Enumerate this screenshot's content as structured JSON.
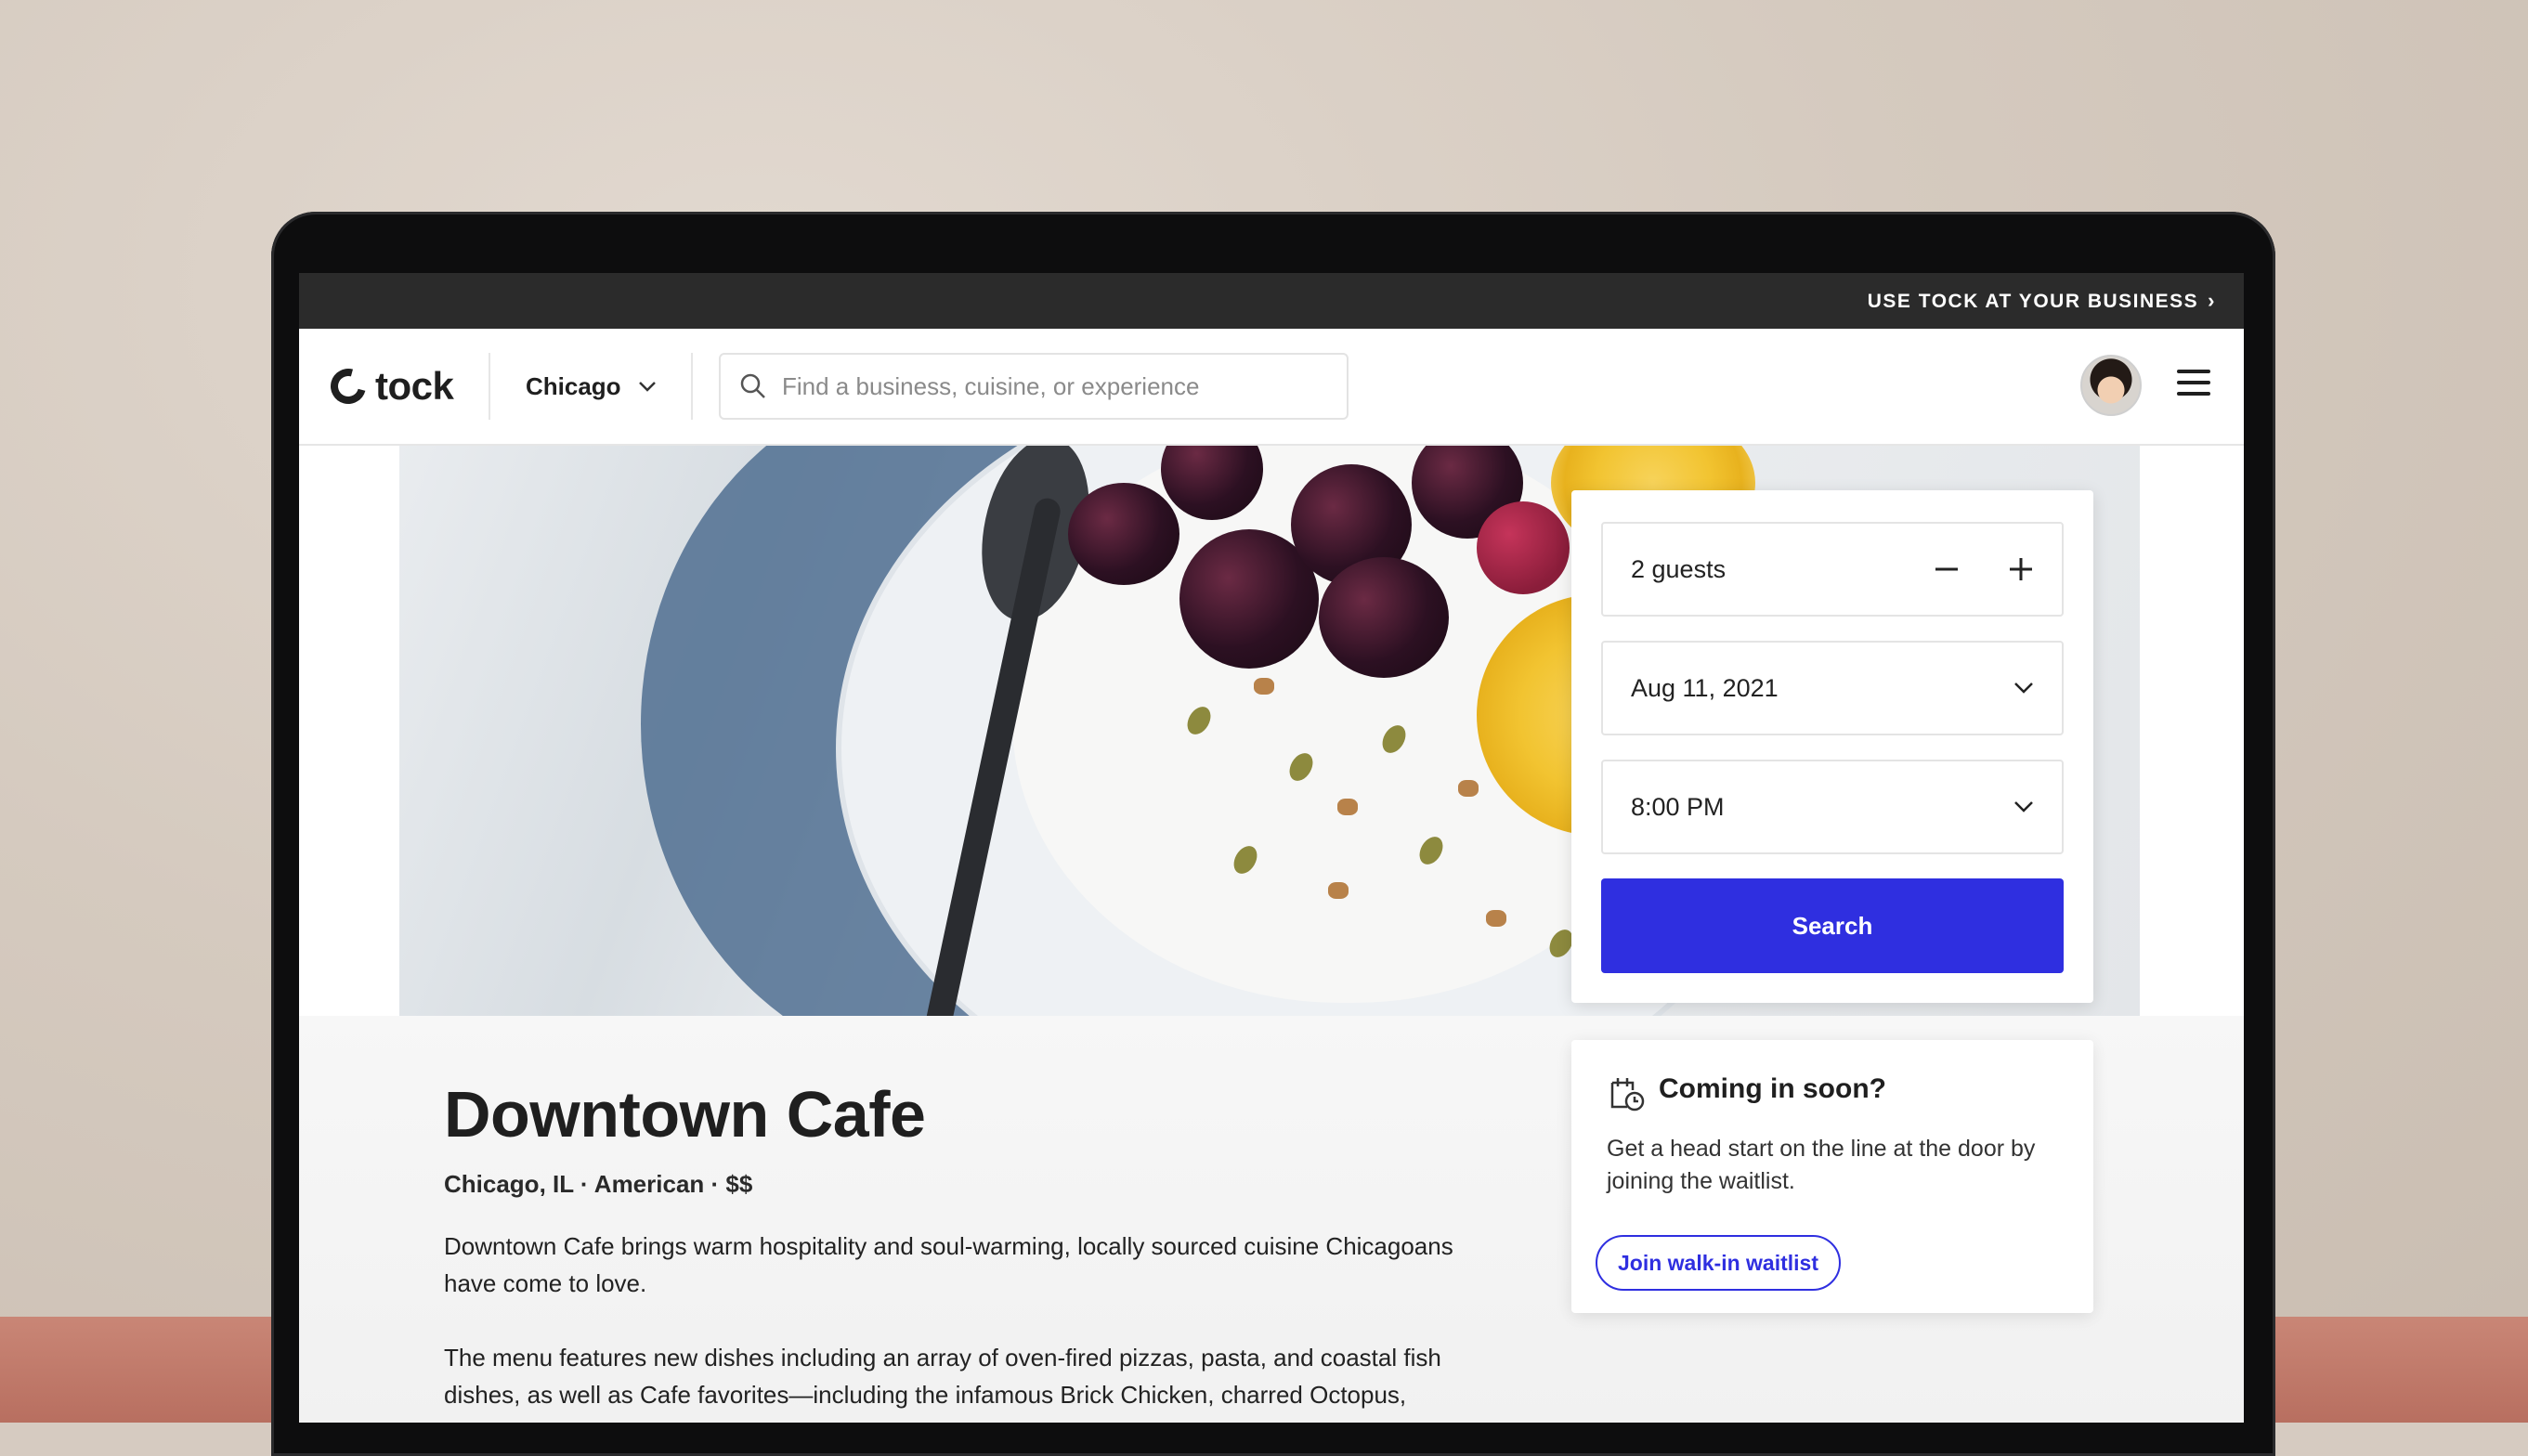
{
  "promo": {
    "link_label": "USE TOCK AT YOUR BUSINESS",
    "chevron": "›"
  },
  "header": {
    "logo_text": "tock",
    "city": "Chicago",
    "search_placeholder": "Find a business, cuisine, or experience"
  },
  "booking": {
    "guests": "2 guests",
    "date": "Aug 11, 2021",
    "time": "8:00 PM",
    "search_label": "Search"
  },
  "restaurant": {
    "name": "Downtown Cafe",
    "meta": "Chicago, IL · American · $$",
    "description_1": "Downtown Cafe brings warm hospitality and soul-warming, locally sourced cuisine Chicagoans have come to love.",
    "description_2": "The menu features new dishes including an array of oven-fired pizzas, pasta, and coastal fish dishes, as well as Cafe favorites—including the infamous Brick Chicken, charred Octopus,"
  },
  "waitlist": {
    "title": "Coming in soon?",
    "body": "Get a head start on the line at the door by joining the waitlist.",
    "button_label": "Join walk-in waitlist"
  },
  "icons": {
    "logo": "tock-logo-icon",
    "city_dropdown": "chevron-down-icon",
    "search": "search-icon",
    "avatar": "user-avatar",
    "menu": "hamburger-menu-icon",
    "minus": "minus-icon",
    "plus": "plus-icon",
    "waitlist": "calendar-clock-icon"
  },
  "colors": {
    "accent": "#2f2fe0",
    "promo_bar": "#2b2b2b",
    "text": "#1f1f1f"
  }
}
